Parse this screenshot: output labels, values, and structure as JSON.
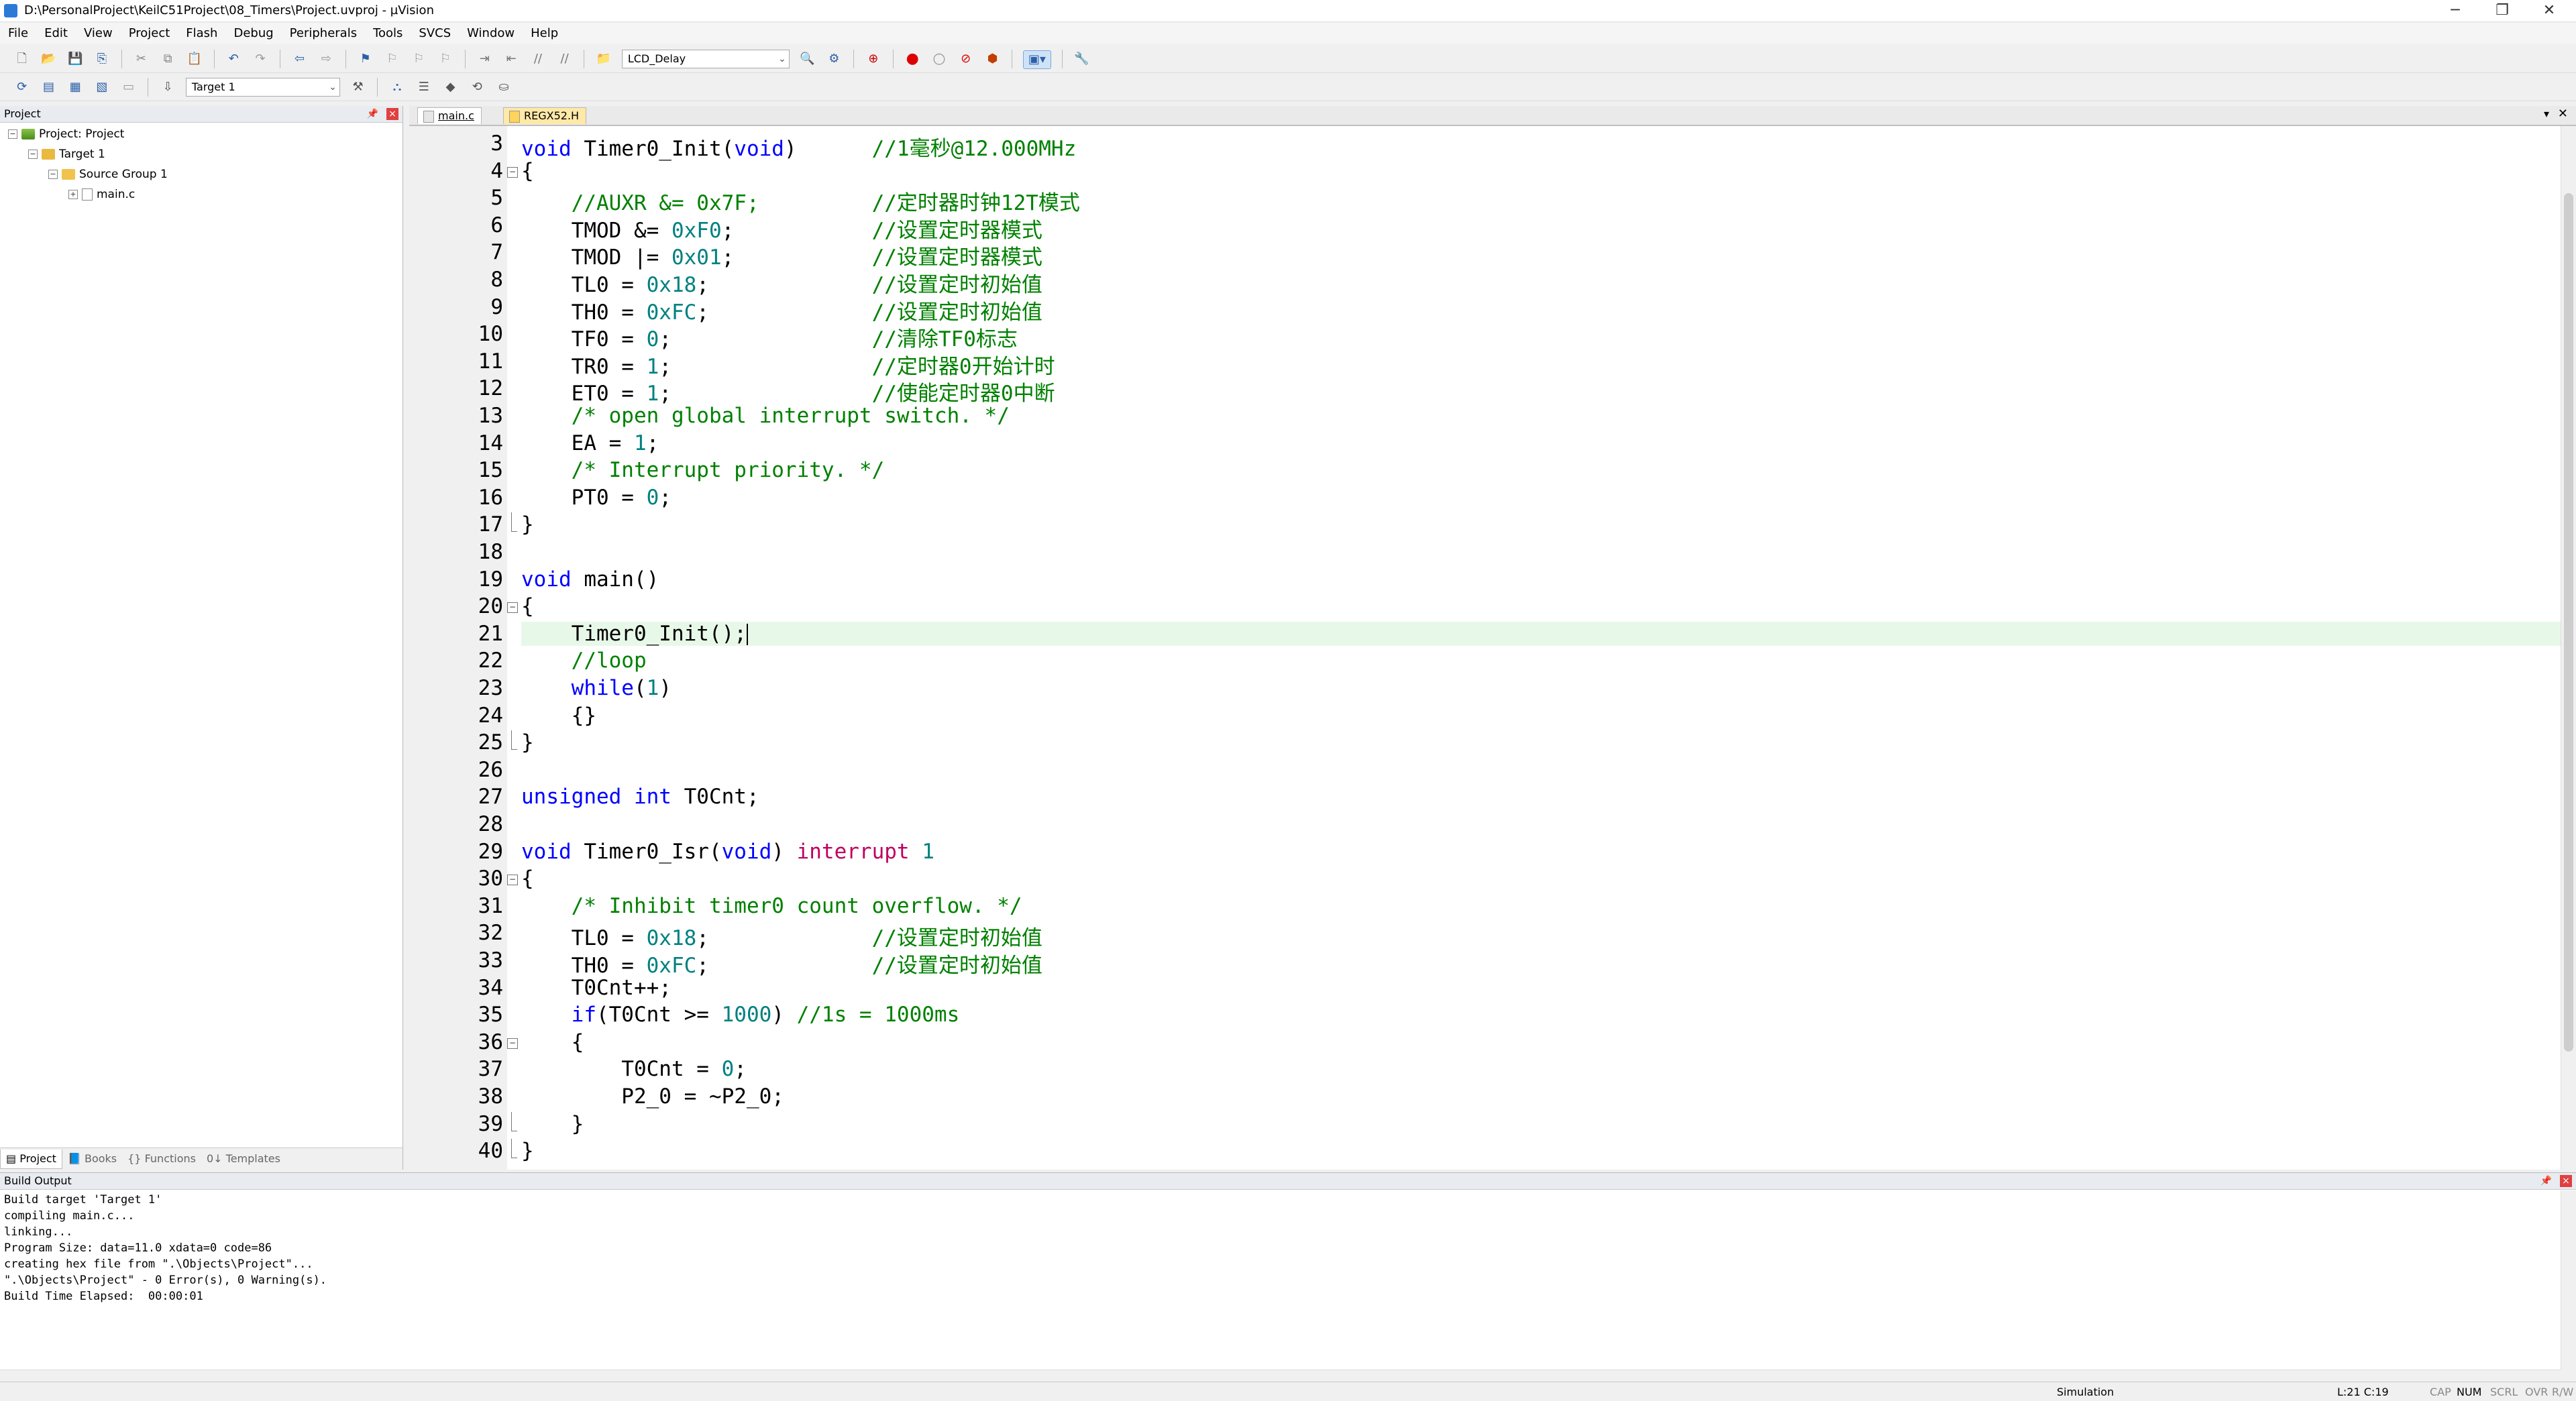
{
  "window": {
    "title": "D:\\PersonalProject\\KeilC51Project\\08_Timers\\Project.uvproj - µVision",
    "min": "─",
    "max": "❐",
    "close": "✕"
  },
  "menu": [
    "File",
    "Edit",
    "View",
    "Project",
    "Flash",
    "Debug",
    "Peripherals",
    "Tools",
    "SVCS",
    "Window",
    "Help"
  ],
  "toolbar": {
    "function_combo": "LCD_Delay",
    "target_combo": "Target 1"
  },
  "project_panel": {
    "header": "Project",
    "tree": [
      "Project: Project",
      "Target 1",
      "Source Group 1",
      "main.c"
    ],
    "tabs": [
      "Project",
      "Books",
      "Functions",
      "Templates"
    ]
  },
  "editor": {
    "tabs": [
      "main.c",
      "REGX52.H"
    ],
    "lines": [
      {
        "n": "3",
        "t": "void Timer0_Init(void)      //1毫秒@12.000MHz"
      },
      {
        "n": "4",
        "t": "{"
      },
      {
        "n": "5",
        "t": "    //AUXR &= 0x7F;         //定时器时钟12T模式"
      },
      {
        "n": "6",
        "t": "    TMOD &= 0xF0;           //设置定时器模式"
      },
      {
        "n": "7",
        "t": "    TMOD |= 0x01;           //设置定时器模式"
      },
      {
        "n": "8",
        "t": "    TL0 = 0x18;             //设置定时初始值"
      },
      {
        "n": "9",
        "t": "    TH0 = 0xFC;             //设置定时初始值"
      },
      {
        "n": "10",
        "t": "    TF0 = 0;                //清除TF0标志"
      },
      {
        "n": "11",
        "t": "    TR0 = 1;                //定时器0开始计时"
      },
      {
        "n": "12",
        "t": "    ET0 = 1;                //使能定时器0中断"
      },
      {
        "n": "13",
        "t": "    /* open global interrupt switch. */"
      },
      {
        "n": "14",
        "t": "    EA = 1;"
      },
      {
        "n": "15",
        "t": "    /* Interrupt priority. */"
      },
      {
        "n": "16",
        "t": "    PT0 = 0;"
      },
      {
        "n": "17",
        "t": "}"
      },
      {
        "n": "18",
        "t": ""
      },
      {
        "n": "19",
        "t": "void main()"
      },
      {
        "n": "20",
        "t": "{"
      },
      {
        "n": "21",
        "t": "    Timer0_Init();"
      },
      {
        "n": "22",
        "t": "    //loop"
      },
      {
        "n": "23",
        "t": "    while(1)"
      },
      {
        "n": "24",
        "t": "    {}"
      },
      {
        "n": "25",
        "t": "}"
      },
      {
        "n": "26",
        "t": ""
      },
      {
        "n": "27",
        "t": "unsigned int T0Cnt;"
      },
      {
        "n": "28",
        "t": ""
      },
      {
        "n": "29",
        "t": "void Timer0_Isr(void) interrupt 1"
      },
      {
        "n": "30",
        "t": "{"
      },
      {
        "n": "31",
        "t": "    /* Inhibit timer0 count overflow. */"
      },
      {
        "n": "32",
        "t": "    TL0 = 0x18;             //设置定时初始值"
      },
      {
        "n": "33",
        "t": "    TH0 = 0xFC;             //设置定时初始值"
      },
      {
        "n": "34",
        "t": "    T0Cnt++;"
      },
      {
        "n": "35",
        "t": "    if(T0Cnt >= 1000) //1s = 1000ms"
      },
      {
        "n": "36",
        "t": "    {"
      },
      {
        "n": "37",
        "t": "        T0Cnt = 0;"
      },
      {
        "n": "38",
        "t": "        P2_0 = ~P2_0;"
      },
      {
        "n": "39",
        "t": "    }"
      },
      {
        "n": "40",
        "t": "}"
      }
    ]
  },
  "build_output": {
    "header": "Build Output",
    "lines": [
      "Build target 'Target 1'",
      "compiling main.c...",
      "linking...",
      "Program Size: data=11.0 xdata=0 code=86",
      "creating hex file from \".\\Objects\\Project\"...",
      "\".\\Objects\\Project\" - 0 Error(s), 0 Warning(s).",
      "Build Time Elapsed:  00:00:01"
    ]
  },
  "status": {
    "mode": "Simulation",
    "position": "L:21 C:19",
    "cap": "CAP",
    "num": "NUM",
    "scrl": "SCRL",
    "ovr": "OVR",
    "rw": "R/W"
  }
}
